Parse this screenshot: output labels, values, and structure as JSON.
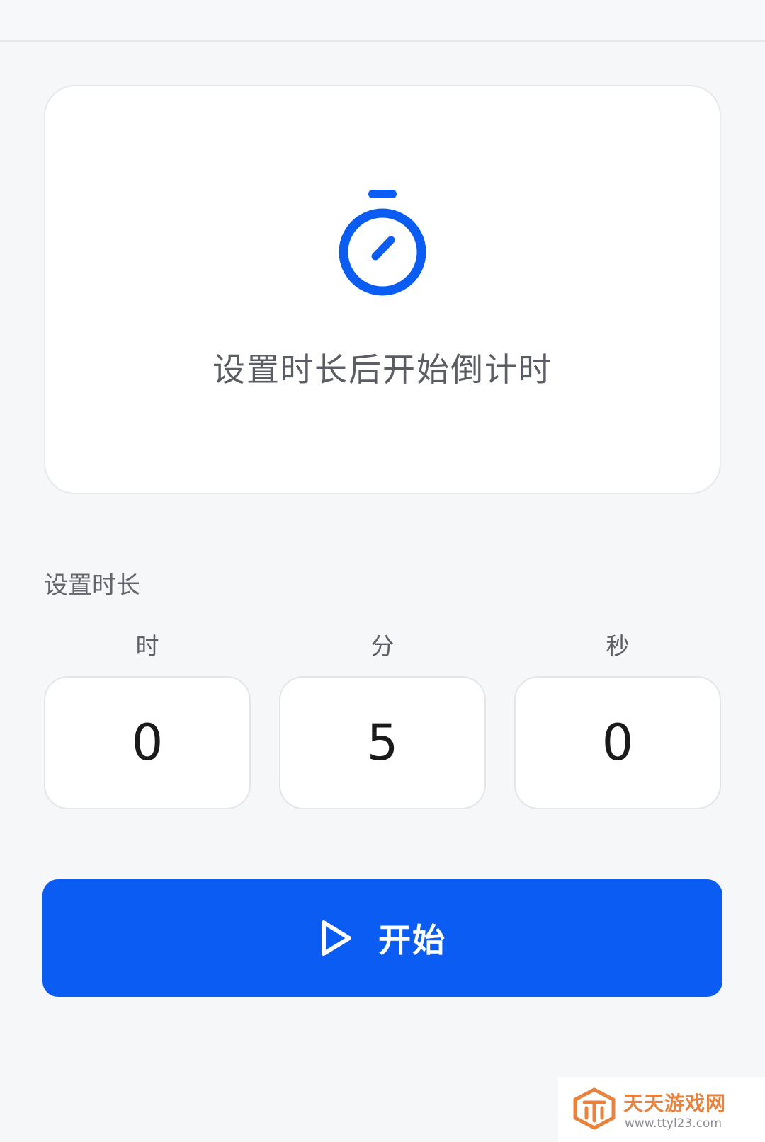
{
  "status_card": {
    "message": "设置时长后开始倒计时",
    "icon": "stopwatch-icon"
  },
  "duration": {
    "section_label": "设置时长",
    "units": [
      {
        "label": "时",
        "value": "0"
      },
      {
        "label": "分",
        "value": "5"
      },
      {
        "label": "秒",
        "value": "0"
      }
    ]
  },
  "start_button": {
    "label": "开始",
    "icon": "play-icon"
  },
  "watermark": {
    "title": "天天游戏网",
    "url": "www.ttyl23.com"
  },
  "colors": {
    "accent": "#0a5cf2",
    "background": "#f6f7f9",
    "card": "#ffffff",
    "watermark": "#e8823c"
  }
}
